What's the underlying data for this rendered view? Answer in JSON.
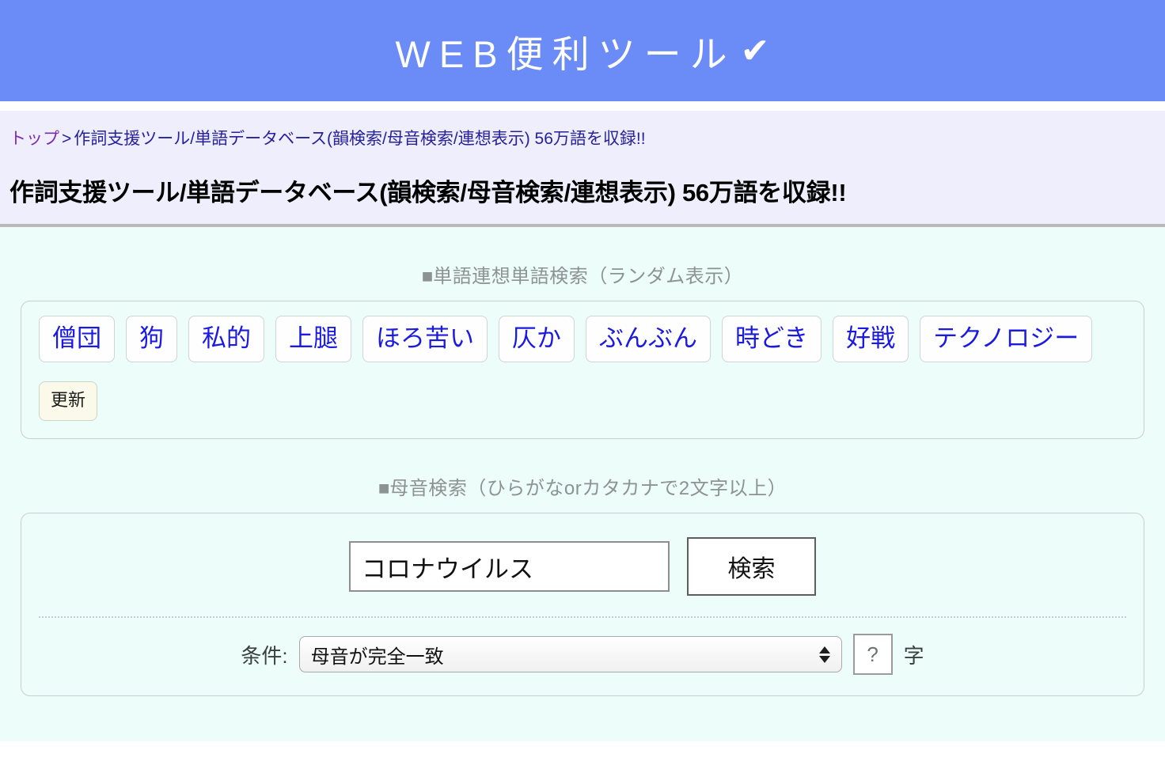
{
  "header": {
    "site_title": "WEB便利ツール",
    "check_glyph": "✔",
    "bg_color": "#6b8cf7"
  },
  "breadcrumb": {
    "top_label": "トップ",
    "separator": ">",
    "current": "作詞支援ツール/単語データベース(韻検索/母音検索/連想表示) 56万語を収録!!"
  },
  "page_title": "作詞支援ツール/単語データベース(韻検索/母音検索/連想表示) 56万語を収録!!",
  "association": {
    "heading_square": "■",
    "heading": "単語連想単語検索（ランダム表示）",
    "words": [
      "僧団",
      "狗",
      "私的",
      "上腿",
      "ほろ苦い",
      "仄か",
      "ぶんぶん",
      "時どき",
      "好戦",
      "テクノロジー"
    ],
    "refresh_label": "更新"
  },
  "vowel_search": {
    "heading_square": "■",
    "heading": "母音検索（ひらがなorカタカナで2文字以上）",
    "query_value": "コロナウイルス",
    "search_button_label": "検索",
    "condition_label": "条件:",
    "condition_selected": "母音が完全一致",
    "condition_options": [
      "母音が完全一致"
    ],
    "length_placeholder": "?",
    "length_unit": "字"
  }
}
